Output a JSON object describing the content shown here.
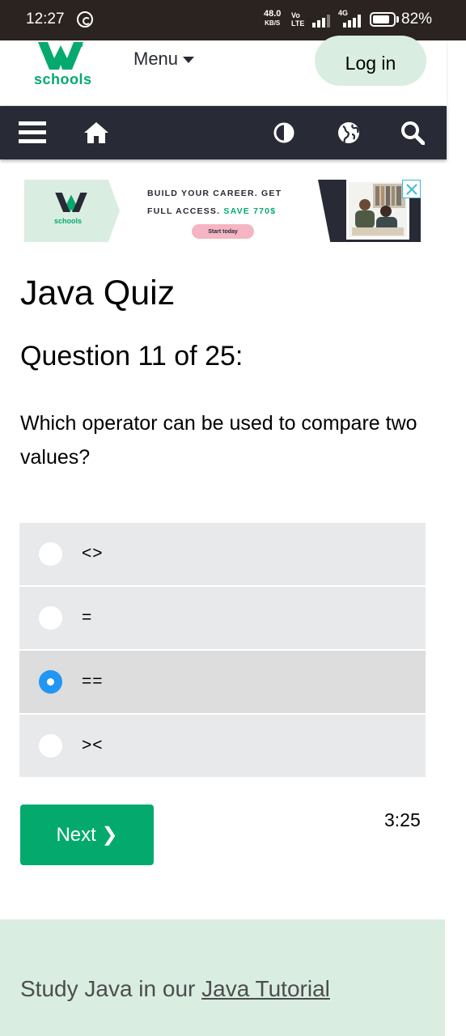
{
  "status_bar": {
    "time": "12:27",
    "net_speed_value": "48.0",
    "net_speed_unit": "KB/S",
    "volte_top": "Vo",
    "volte_bottom": "LTE",
    "network_type": "4G",
    "battery_percent": "82%",
    "battery_level": 0.82
  },
  "header": {
    "logo_text": "schools",
    "menu_label": "Menu",
    "login_label": "Log in"
  },
  "navbar": {
    "icons": [
      "hamburger-icon",
      "home-icon",
      "contrast-icon",
      "globe-icon",
      "search-icon"
    ]
  },
  "ad": {
    "logo_text": "schools",
    "line1": "BUILD YOUR CAREER. GET",
    "line2_prefix": "FULL ACCESS. ",
    "line2_highlight": "SAVE 770$",
    "cta_label": "Start today"
  },
  "quiz": {
    "title": "Java Quiz",
    "question_number": "Question 11 of 25:",
    "question_text": "Which operator can be used to compare two values?",
    "options": [
      {
        "label": "<>",
        "checked": false
      },
      {
        "label": "=",
        "checked": false
      },
      {
        "label": "==",
        "checked": true
      },
      {
        "label": "><",
        "checked": false
      }
    ],
    "next_label": "Next ❯",
    "timer": "3:25"
  },
  "footer": {
    "prefix": "Study Java in our ",
    "link_text": "Java Tutorial"
  },
  "colors": {
    "brand_green": "#04aa6d",
    "nav_dark": "#282a35",
    "light_green": "#d9eee1",
    "radio_blue": "#2196f3"
  }
}
